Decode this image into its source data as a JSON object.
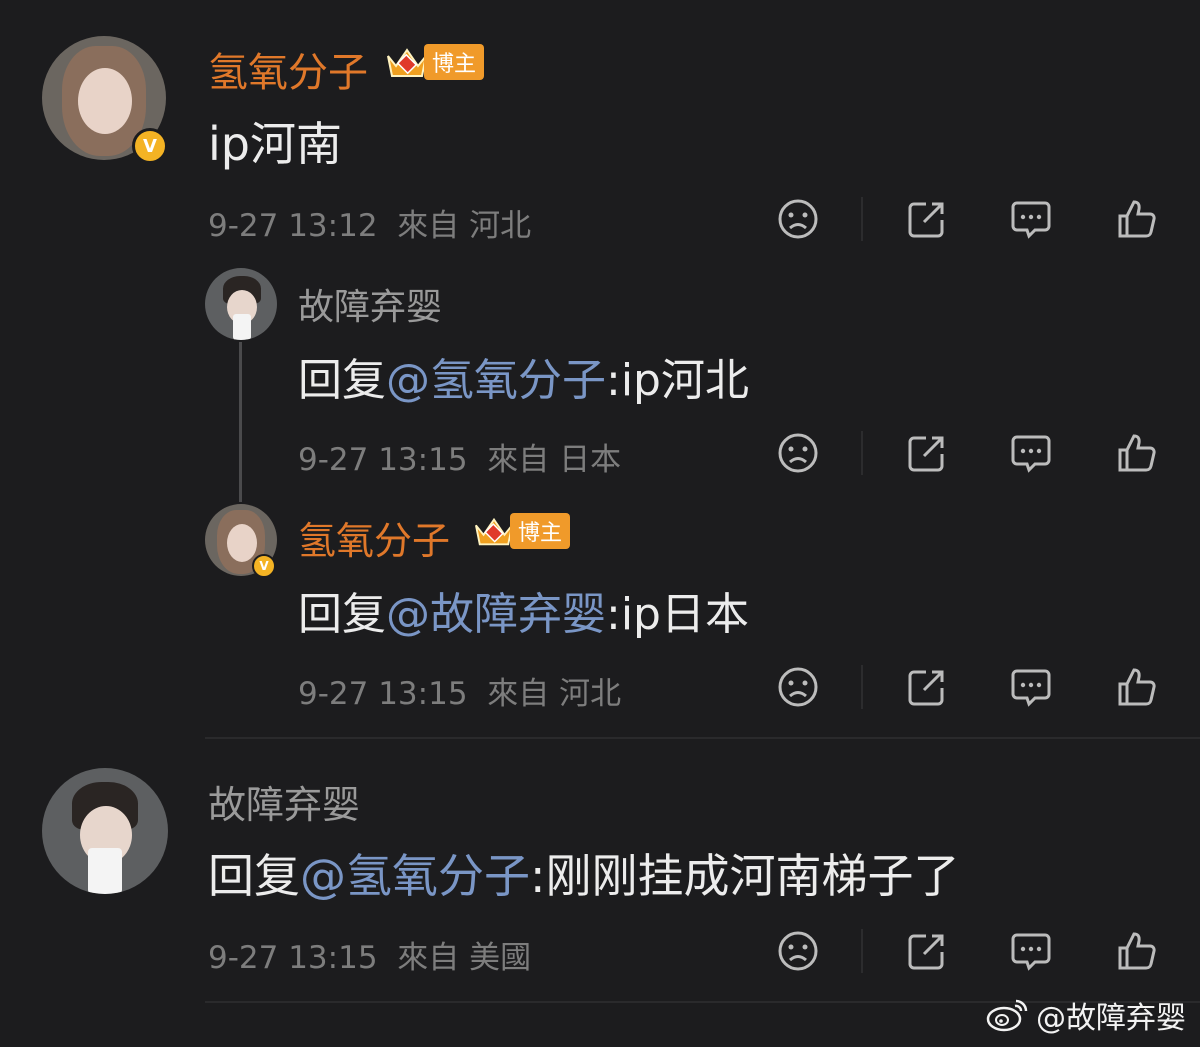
{
  "colors": {
    "blogger_name": "#e0782a",
    "mention": "#7a96c6",
    "verified": "#f4b324"
  },
  "comments": [
    {
      "username": "氢氧分子",
      "badge": "博主",
      "reply_prefix": "",
      "mention": "",
      "text": "ip河南",
      "time": "9-27 13:12",
      "from": "來自 河北"
    },
    {
      "username": "故障弃婴",
      "badge": "",
      "reply_prefix": "回复",
      "mention": "@氢氧分子",
      "text": ":ip河北",
      "time": "9-27 13:15",
      "from": "來自 日本"
    },
    {
      "username": "氢氧分子",
      "badge": "博主",
      "reply_prefix": "回复",
      "mention": "@故障弃婴",
      "text": ":ip日本",
      "time": "9-27 13:15",
      "from": "來自 河北"
    },
    {
      "username": "故障弃婴",
      "badge": "",
      "reply_prefix": "回复",
      "mention": "@氢氧分子",
      "text": ":刚刚挂成河南梯子了",
      "time": "9-27 13:15",
      "from": "來自 美國"
    }
  ],
  "icons": [
    "dislike-icon",
    "share-icon",
    "comment-icon",
    "like-icon",
    "verified-icon",
    "crown-icon",
    "weibo-logo-icon"
  ],
  "verified_label": "V",
  "watermark": "@故障弃婴"
}
